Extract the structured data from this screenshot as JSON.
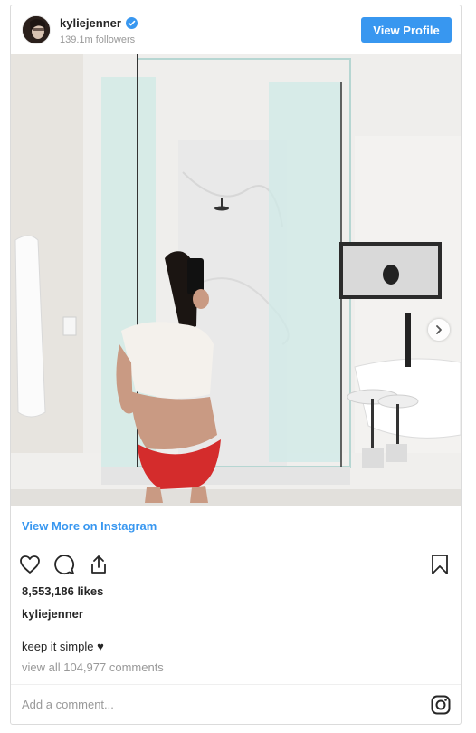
{
  "header": {
    "username": "kyliejenner",
    "followers": "139.1m followers",
    "view_profile_label": "View Profile"
  },
  "icons": {
    "verified": "verified-badge-icon",
    "next": "chevron-right-icon",
    "like": "heart-icon",
    "comment": "comment-bubble-icon",
    "share": "share-icon",
    "save": "bookmark-icon",
    "brand": "instagram-icon"
  },
  "colors": {
    "accent": "#3897f0",
    "text": "#262626",
    "muted": "#999999"
  },
  "post": {
    "view_more_label": "View More on Instagram",
    "likes": "8,553,186 likes",
    "owner": "kyliejenner",
    "caption": "keep it simple ♥",
    "view_comments": "view all 104,977 comments",
    "comment_placeholder": "Add a comment..."
  }
}
